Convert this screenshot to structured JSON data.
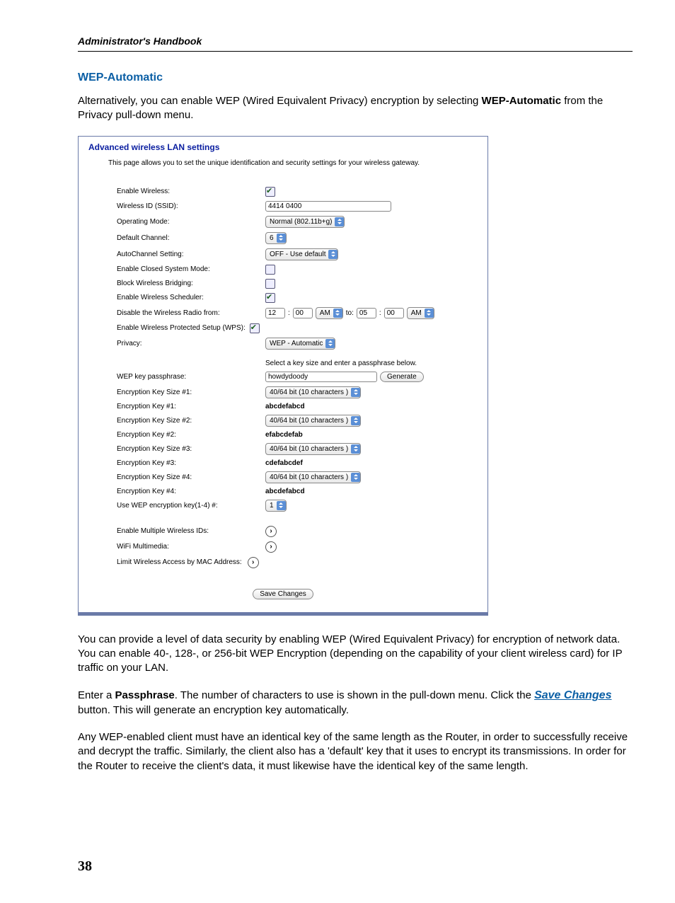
{
  "running_head": "Administrator's Handbook",
  "section_title": "WEP-Automatic",
  "intro": {
    "line1a": "Alternatively, you can enable WEP (Wired Equivalent Privacy) encryption by selecting ",
    "bold": "WEP-Automatic",
    "line1b": " from the Privacy pull-down menu."
  },
  "panel": {
    "title": "Advanced wireless LAN settings",
    "desc": "This page allows you to set the unique identification and security settings for your wireless gateway.",
    "labels": {
      "enable_wireless": "Enable Wireless:",
      "ssid": "Wireless ID (SSID):",
      "op_mode": "Operating Mode:",
      "def_channel": "Default Channel:",
      "autochan": "AutoChannel Setting:",
      "closed": "Enable Closed System Mode:",
      "bridge": "Block Wireless Bridging:",
      "scheduler": "Enable Wireless Scheduler:",
      "disable_from": "Disable the Wireless Radio from:",
      "wps": "Enable Wireless Protected Setup (WPS):",
      "privacy": "Privacy:",
      "note": "Select a key size and enter a passphrase below.",
      "passphrase": "WEP key passphrase:",
      "size1": "Encryption Key Size #1:",
      "key1": "Encryption Key #1:",
      "size2": "Encryption Key Size #2:",
      "key2": "Encryption Key #2:",
      "size3": "Encryption Key Size #3:",
      "key3": "Encryption Key #3:",
      "size4": "Encryption Key Size #4:",
      "key4": "Encryption Key #4:",
      "usekey": "Use WEP encryption key(1-4) #:",
      "multi": "Enable Multiple Wireless IDs:",
      "wmm": "WiFi Multimedia:",
      "mac": "Limit Wireless Access by MAC Address:"
    },
    "values": {
      "ssid": "4414 0400",
      "op_mode": "Normal (802.11b+g)",
      "def_channel": "6",
      "autochan": "OFF - Use default",
      "time_from_h": "12",
      "time_from_m": "00",
      "time_from_ampm": "AM",
      "to": "to:",
      "time_to_h": "05",
      "time_to_m": "00",
      "time_to_ampm": "AM",
      "privacy": "WEP - Automatic",
      "passphrase": "howdydoody",
      "generate": "Generate",
      "keysize": "40/64 bit (10 characters )",
      "key1": "abcdefabcd",
      "key2": "efabcdefab",
      "key3": "cdefabcdef",
      "key4": "abcdefabcd",
      "usekey": "1",
      "save": "Save Changes"
    }
  },
  "para1": "You can provide a level of data security by enabling WEP (Wired Equivalent Privacy) for encryption of network data. You can enable 40-, 128-, or 256-bit WEP Encryption (depending on the capability of your client wireless card) for IP traffic on your LAN.",
  "para2": {
    "a": "Enter a ",
    "b": "Passphrase",
    "c": ". The number of characters to use is shown in the pull-down menu. Click the ",
    "d": "Save Changes",
    "e": " button. This will generate an encryption key automatically."
  },
  "para3": "Any WEP-enabled client must have an identical key of the same length as the Router, in order to successfully receive and decrypt the traffic. Similarly, the client also has a 'default' key that it uses to encrypt its transmissions. In order for the Router to receive the client's data, it must likewise have the identical key of the same length.",
  "page_number": "38"
}
